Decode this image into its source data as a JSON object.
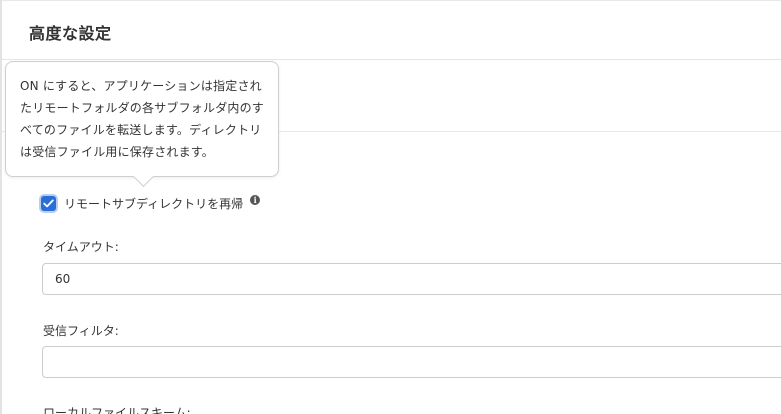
{
  "header": {
    "title": "高度な設定"
  },
  "tooltip": {
    "text": "ON にすると、アプリケーションは指定されたリモートフォルダの各サブフォルダ内のすべてのファイルを転送します。ディレクトリは受信ファイル用に保存されます。"
  },
  "recurse": {
    "checked": true,
    "label": "リモートサブディレクトリを再帰",
    "info_icon": "info-icon"
  },
  "timeout": {
    "label": "タイムアウト:",
    "value": "60"
  },
  "receive_filter": {
    "label": "受信フィルタ:",
    "value": ""
  },
  "local_file_scheme": {
    "label": "ローカルファイルスキーム:"
  },
  "colors": {
    "accent": "#2b6fd6",
    "border": "#cccccc",
    "text": "#333333"
  }
}
